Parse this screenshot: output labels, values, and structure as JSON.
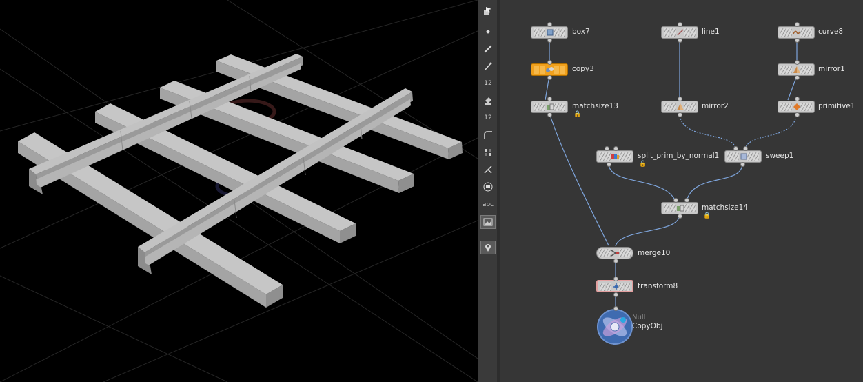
{
  "viewport": {
    "name": "3d-viewport",
    "background": "#000000",
    "mesh_color": "#b9b9b9"
  },
  "toolbar": {
    "items": [
      {
        "icon": "select-tool-icon"
      },
      {
        "icon": "point-icon"
      },
      {
        "icon": "brush-icon"
      },
      {
        "icon": "pen-icon"
      },
      {
        "icon": "point-number-icon",
        "text": "12"
      },
      {
        "icon": "paint-bucket-icon"
      },
      {
        "icon": "primitive-number-icon",
        "text": "12"
      },
      {
        "icon": "curve-icon"
      },
      {
        "icon": "snap-grid-icon"
      },
      {
        "icon": "transform-handle-icon"
      },
      {
        "icon": "frame-icon"
      },
      {
        "icon": "text-icon",
        "text": "abc"
      },
      {
        "icon": "background-image-icon"
      },
      {
        "icon": "location-pin-icon"
      }
    ]
  },
  "network": {
    "background": "#363636",
    "wire_color": "#7ea5dc",
    "nodes": {
      "box7": "box7",
      "line1": "line1",
      "curve8": "curve8",
      "copy3": "copy3",
      "mirror1": "mirror1",
      "matchsize13": "matchsize13",
      "mirror2": "mirror2",
      "primitive1": "primitive1",
      "split": "split_prim_by_normal1",
      "sweep1": "sweep1",
      "matchsize14": "matchsize14",
      "merge10": "merge10",
      "transform8": "transform8"
    },
    "null_node": {
      "type": "Null",
      "name": "CopyObj"
    },
    "highlight_color": "#f0a01c"
  }
}
